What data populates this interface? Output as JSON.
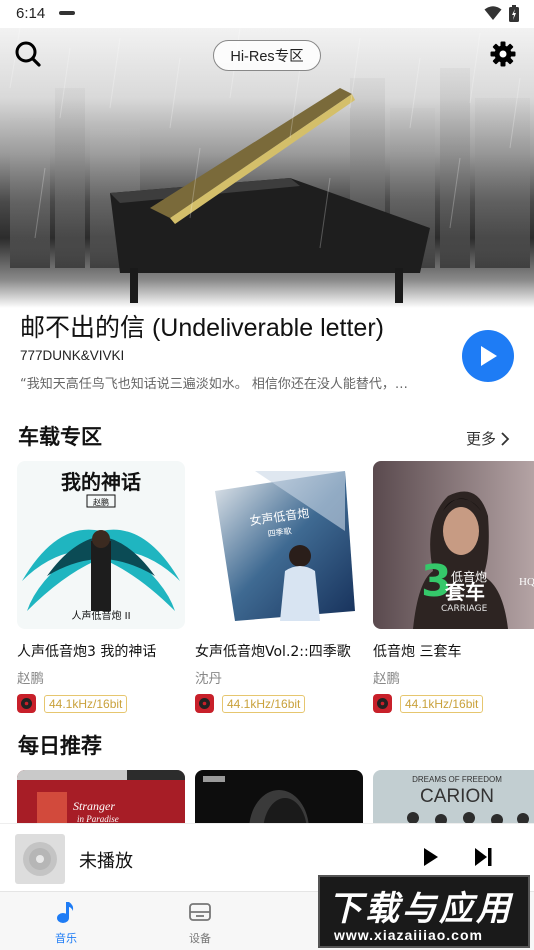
{
  "status": {
    "time": "6:14"
  },
  "header": {
    "hires_label": "Hi-Res专区"
  },
  "featured": {
    "title": "邮不出的信 (Undeliverable letter)",
    "artist": "777DUNK&VIVKI",
    "quote": "“我知天高任鸟飞也知话说三遍淡如水。 相信你还在没人能替代，…"
  },
  "car_section": {
    "title": "车载专区",
    "more_label": "更多",
    "cards": [
      {
        "title": "人声低音炮3 我的神话",
        "artist": "赵鹏",
        "badge": "44.1kHz/16bit",
        "cover_text": "我的神话",
        "cover_sub": "赵鹏"
      },
      {
        "title": "女声低音炮Vol.2::四季歌",
        "artist": "沈丹",
        "badge": "44.1kHz/16bit",
        "cover_text": "女声低音炮",
        "cover_sub": "四季歌"
      },
      {
        "title": "低音炮 三套车",
        "artist": "赵鹏",
        "badge": "44.1kHz/16bit",
        "cover_text": "低音炮 套车",
        "cover_sub": "CARRIAGE"
      }
    ]
  },
  "daily_section": {
    "title": "每日推荐",
    "covers": [
      {
        "text": "Stranger in Paradise"
      },
      {
        "text": ""
      },
      {
        "text": "CARION"
      }
    ]
  },
  "mini_player": {
    "title": "未播放"
  },
  "nav": [
    {
      "label": "音乐"
    },
    {
      "label": "设备"
    }
  ],
  "watermark": {
    "big": "下载与应用",
    "small": "www.xiazaiiiao.com"
  },
  "colors": {
    "accent": "#1e7cf5",
    "badge": "#c9a13b",
    "hq_red": "#c8202a"
  }
}
